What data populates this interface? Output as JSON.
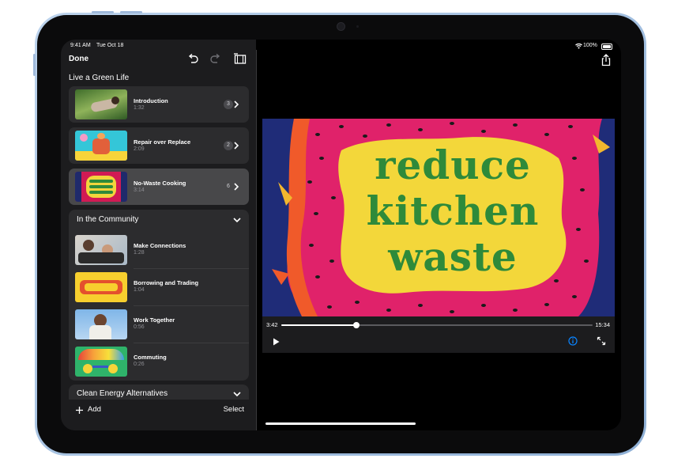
{
  "status_bar": {
    "time": "9:41 AM",
    "date": "Tue Oct 18",
    "battery": "100%"
  },
  "toolbar": {
    "done_label": "Done",
    "undo_icon": "undo-icon",
    "redo_icon": "redo-icon",
    "storyboard_icon": "film-icon",
    "share_icon": "share-icon"
  },
  "sidebar": {
    "project_title": "Live a Green Life",
    "top_clips": [
      {
        "title": "Introduction",
        "duration": "1:32",
        "count": "3"
      },
      {
        "title": "Repair over Replace",
        "duration": "2:09",
        "count": "2"
      },
      {
        "title": "No-Waste Cooking",
        "duration": "3:14",
        "count": "6"
      }
    ],
    "community": {
      "title": "In the Community",
      "items": [
        {
          "title": "Make Connections",
          "duration": "1:28"
        },
        {
          "title": "Borrowing and Trading",
          "duration": "1:04"
        },
        {
          "title": "Work Together",
          "duration": "0:56"
        },
        {
          "title": "Commuting",
          "duration": "0:26"
        }
      ]
    },
    "clean_energy": {
      "title": "Clean Energy Alternatives"
    },
    "add_label": "Add",
    "select_label": "Select"
  },
  "player": {
    "title_art": [
      "reduce",
      "kitchen",
      "waste"
    ],
    "current_time": "3:42",
    "total_time": "15:34",
    "progress": 0.24
  },
  "colors": {
    "accent": "#0a84ff",
    "panel": "#1c1c1e",
    "card": "#2c2c2e",
    "selected": "#48484a",
    "device_frame": "#a9c4e4"
  }
}
